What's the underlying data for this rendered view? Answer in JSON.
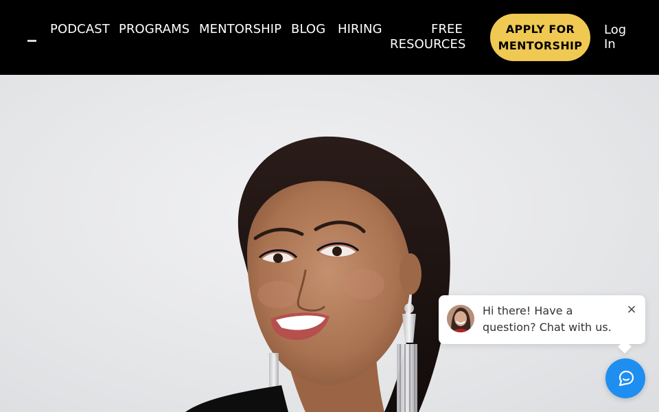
{
  "header": {
    "nav": [
      {
        "label": "PODCAST"
      },
      {
        "label": "PROGRAMS"
      },
      {
        "label": "MENTORSHIP"
      },
      {
        "label": "BLOG"
      },
      {
        "label": "HIRING"
      },
      {
        "label": "FREE RESOURCES"
      }
    ],
    "apply_label": "APPLY FOR MENTORSHIP",
    "login_label": "Log In"
  },
  "chat": {
    "message": "Hi there! Have a question? Chat with us.",
    "close_glyph": "×",
    "launcher_icon": "chat-icon"
  },
  "colors": {
    "header_bg": "#000000",
    "accent": "#f0c952",
    "chat_blue": "#1f8ef1"
  }
}
